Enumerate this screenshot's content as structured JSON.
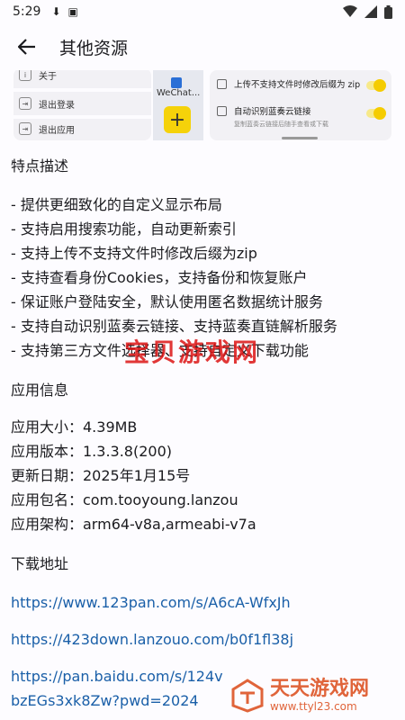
{
  "status_bar": {
    "time": "5:29"
  },
  "app_bar": {
    "title": "其他资源"
  },
  "preview": {
    "left_items": [
      "关于",
      "退出登录",
      "退出应用"
    ],
    "middle_label": "WeChat...",
    "right_items": [
      "上传不支持文件时修改后缀为 zip",
      "自动识别蓝奏云链接"
    ],
    "right_sub": "复制蓝奏云链接后随手查看或下载"
  },
  "features": {
    "title": "特点描述",
    "items": [
      "- 提供更细致化的自定义显示布局",
      "- 支持启用搜索功能，自动更新索引",
      "- 支持上传不支持文件时修改后缀为zip",
      "- 支持查看身份Cookies，支持备份和恢复账户",
      "- 保证账户登陆安全，默认使用匿名数据统计服务",
      "- 支持自动识别蓝奏云链接、支持蓝奏直链解析服务",
      "- 支持第三方文件选择器、支持自定义下载功能"
    ]
  },
  "app_info": {
    "title": "应用信息",
    "rows": [
      "应用大小：4.39MB",
      "应用版本：1.3.3.8(200)",
      "更新日期：2025年1月15号",
      "应用包名：com.tooyoung.lanzou",
      "应用架构：arm64-v8a,armeabi-v7a"
    ]
  },
  "download": {
    "title": "下载地址",
    "links": [
      "https://www.123pan.com/s/A6cA-WfxJh",
      "https://423down.lanzouo.com/b0f1fl38j",
      "https://pan.baidu.com/s/124vbzEGs3xk8Zw?pwd=2024"
    ]
  },
  "watermarks": {
    "center": "宝贝游戏网",
    "corner_title": "天天游戏网",
    "corner_url": "www.ttyl23.com"
  },
  "colors": {
    "link": "#1a5fa8",
    "watermark": "#e0643a",
    "toggle": "#f5cc00"
  }
}
